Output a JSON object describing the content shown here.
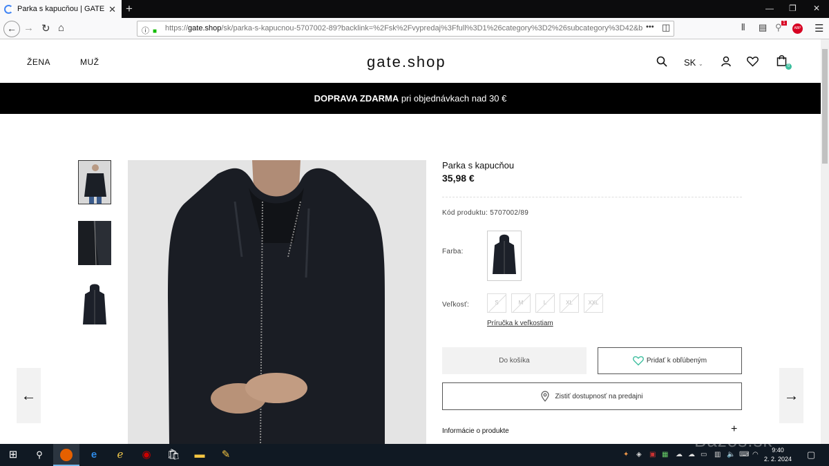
{
  "browser": {
    "tab_title": "Parka s kapucňou | GATE",
    "tab_close": "✕",
    "new_tab": "+",
    "url_prefix": "https://",
    "url_domain": "gate.shop",
    "url_rest": "/sk/parka-s-kapucnou-5707002-89?backlink=%2Fsk%2Fvypredaj%3Ffull%3D1%26category%3D2%26subcategory%3D42&b",
    "url_menu": "•••",
    "notification_badge": "1",
    "abp_label": "ABP"
  },
  "header": {
    "nav_women": "ŽENA",
    "nav_men": "MUŽ",
    "logo": "gate.shop",
    "lang": "SK",
    "cart_count": "0"
  },
  "promo": {
    "bold": "DOPRAVA ZDARMA",
    "rest": " pri objednávkach nad 30 €"
  },
  "product": {
    "title": "Parka s kapucňou",
    "price": "35,98 €",
    "code_label": "Kód produktu: 5707002/89",
    "color_label": "Farba:",
    "size_label": "Veľkosť:",
    "sizes": [
      "S",
      "M",
      "L",
      "XL",
      "XXL"
    ],
    "size_guide": "Príručka k veľkostiam",
    "add_to_cart": "Do košíka",
    "add_to_fav": "Pridať k obľúbeným",
    "check_store": "Zistiť dostupnosť na predajni",
    "info": "Informácie o produkte"
  },
  "gallery": {
    "prev": "←",
    "next": "→"
  },
  "taskbar": {
    "time": "9:40",
    "date": "2. 2. 2024"
  },
  "watermark": "Bazos.sk",
  "colors": {
    "promo_bg": "#000000",
    "accent_heart": "#3fbf9f",
    "taskbar_bg": "#101923"
  }
}
